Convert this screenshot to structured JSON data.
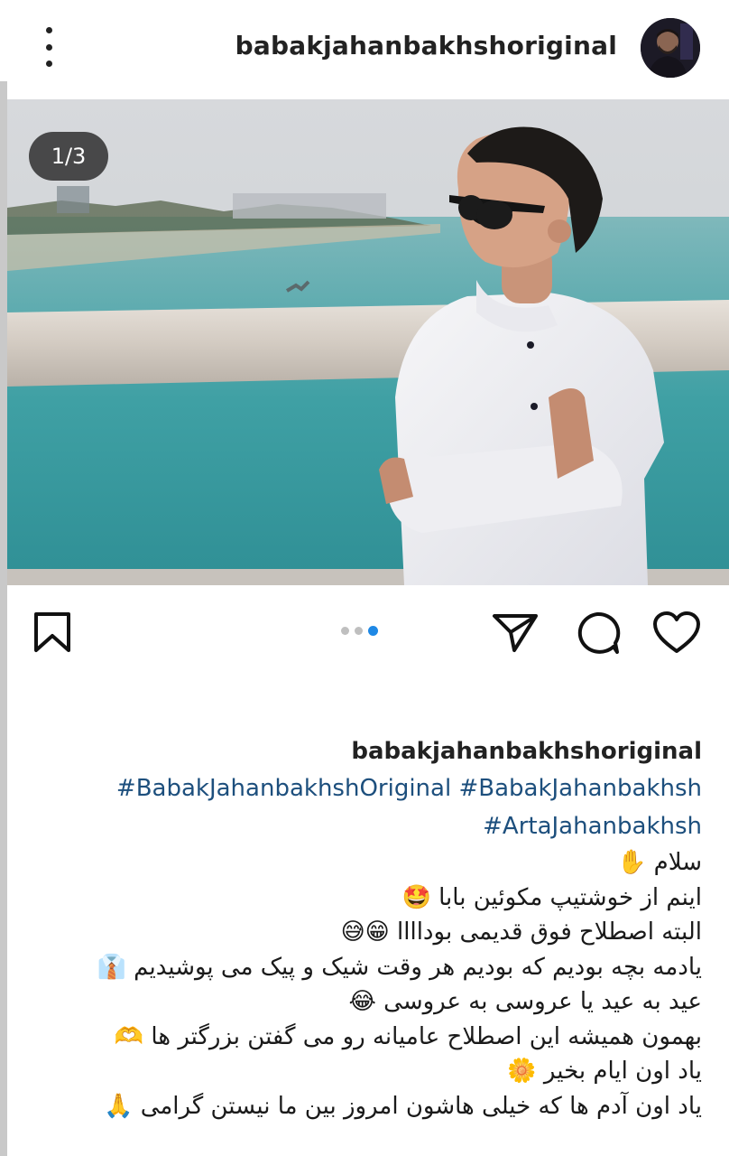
{
  "header": {
    "username": "babakjahanbakhshoriginal",
    "more_icon": "more-vertical-icon",
    "avatar_icon": "profile-avatar"
  },
  "media": {
    "counter": "1/3",
    "current_index": 1,
    "total": 3,
    "content": "photo-boy-at-sea-pier"
  },
  "actions": {
    "like_icon": "heart-icon",
    "comment_icon": "comment-bubble-icon",
    "share_icon": "paper-plane-icon",
    "save_icon": "bookmark-icon",
    "active_color": "#1e88e5"
  },
  "caption": {
    "username": "babakjahanbakhshoriginal",
    "hashtags": [
      "#BabakJahanbakhshOriginal",
      "#BabakJahanbakhsh",
      "#ArtaJahanbakhsh"
    ],
    "hashtag_color": "#1d4f7d",
    "lines": [
      "سلام ✋",
      "اینم از خوشتیپ مکوئین بابا 🤩",
      "البته اصطلاح فوق قدیمی بوداااا 😁😅",
      "یادمه بچه بودیم که بودیم هر وقت شیک و پیک می پوشیدیم 👔",
      "عید به عید یا عروسی به عروسی 😂",
      "بهمون همیشه این اصطلاح عامیانه رو می گفتن بزرگتر ها 🫶",
      "یاد اون ایام بخیر 🌼",
      "یاد اون آدم ها که خیلی هاشون امروز بین ما نیستن گرامی 🙏"
    ]
  }
}
